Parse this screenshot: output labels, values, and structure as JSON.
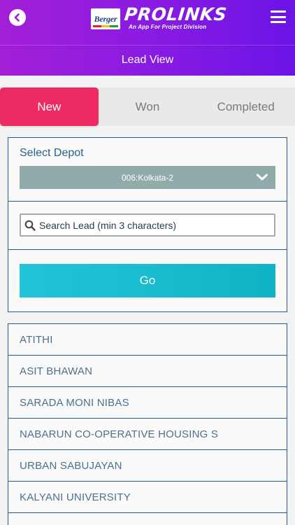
{
  "header": {
    "brand_logo": "Berger",
    "brand_name": "PROLINKS",
    "brand_tagline": "An App For Project Division",
    "page_title": "Lead View",
    "back_icon": "back-arrow-icon",
    "menu_icon": "hamburger-menu-icon"
  },
  "tabs": [
    {
      "label": "New",
      "active": true
    },
    {
      "label": "Won",
      "active": false
    },
    {
      "label": "Completed",
      "active": false
    }
  ],
  "filters": {
    "depot_label": "Select Depot",
    "depot_value": "006:Kolkata-2",
    "search_placeholder": "Search Lead (min 3 characters)",
    "go_label": "Go"
  },
  "leads": [
    "ATITHI",
    "ASIT BHAWAN",
    "SARADA MONI NIBAS",
    "NABARUN CO-OPERATIVE HOUSING S",
    "URBAN SABUJAYAN",
    "KALYANI UNIVERSITY"
  ],
  "colors": {
    "header_gradient_start": "#a21fd6",
    "header_gradient_end": "#6b14e6",
    "active_tab": "#ee2a62",
    "go_button": "#1bbccf",
    "depot_select": "#90abaa",
    "border": "#1f5e8f"
  }
}
